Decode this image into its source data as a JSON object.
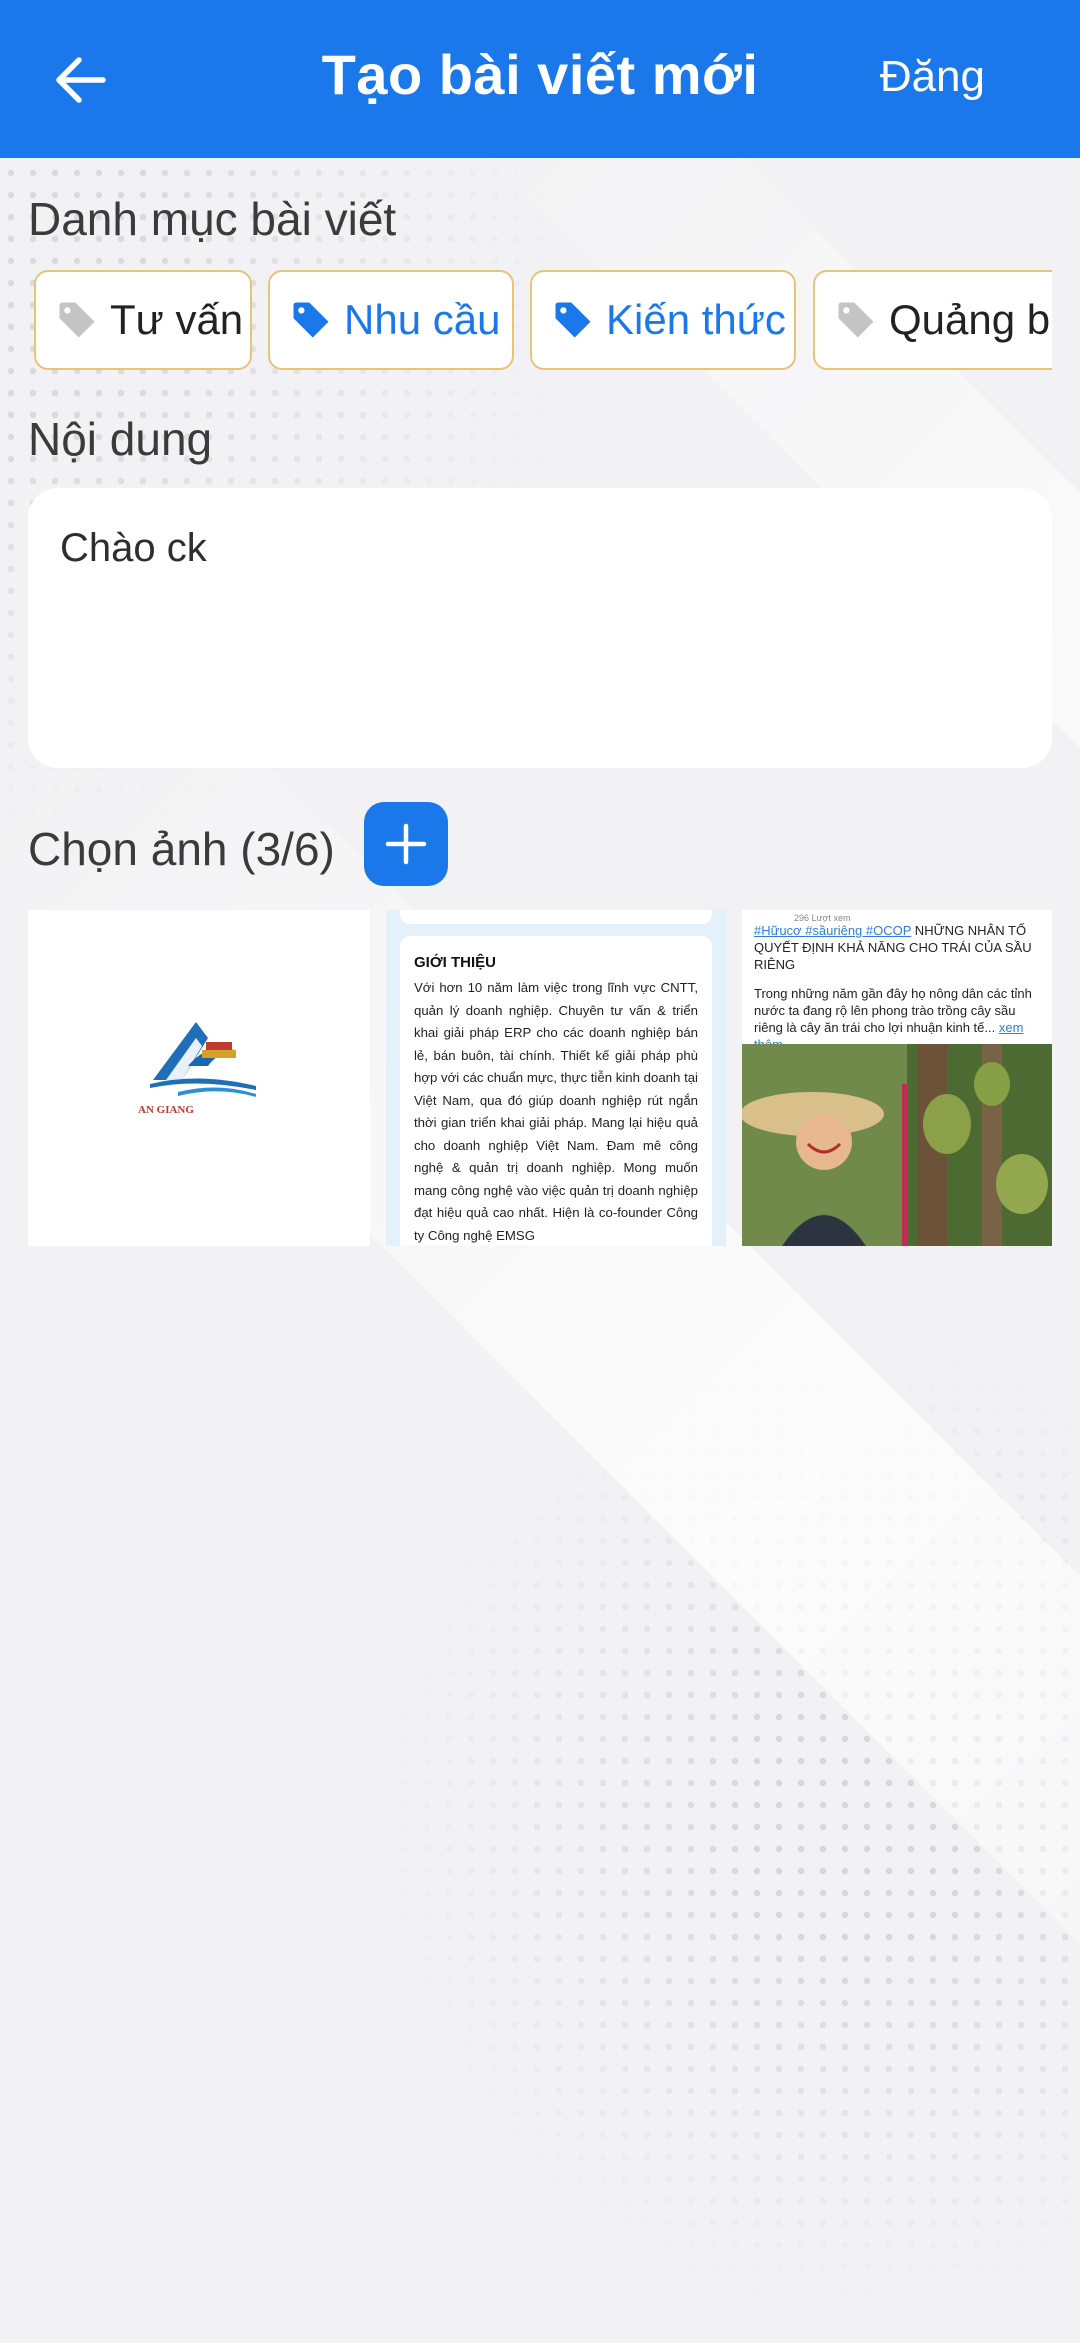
{
  "header": {
    "title": "Tạo bài viết mới",
    "post_label": "Đăng"
  },
  "category": {
    "title": "Danh mục bài viết",
    "chips": [
      {
        "label": "Tư vấn",
        "active": false
      },
      {
        "label": "Nhu cầu",
        "active": true
      },
      {
        "label": "Kiến thức",
        "active": true
      },
      {
        "label": "Quảng bá",
        "active": false
      }
    ]
  },
  "content": {
    "title": "Nội dung",
    "value": "Chào ck"
  },
  "images": {
    "title": "Chọn ảnh (3/6)",
    "thumbs": [
      {
        "logo_text": "AN GIANG"
      },
      {
        "heading": "GIỚI THIỆU",
        "body": "Với hơn 10 năm làm việc trong lĩnh vực CNTT, quản lý doanh nghiệp. Chuyên tư vấn & triển khai giải pháp ERP cho các doanh nghiệp bán lẻ, bán buôn, tài chính. Thiết kế giải pháp phù hợp với các chuẩn mực, thực tiễn kinh doanh tại Việt Nam, qua đó giúp doanh nghiệp rút ngắn thời gian triển khai giải pháp. Mang lại hiệu quả cho doanh nghiệp Việt Nam. Đam mê công nghệ & quản trị doanh nghiệp. Mong muốn mang công nghệ vào việc quản trị doanh nghiệp đạt hiệu quả cao nhất. Hiện là co-founder Công ty Công nghệ EMSG"
      },
      {
        "meta": "296 Lượt xem",
        "tags": "#Hữucơ #sầuriêng #OCOP",
        "headline": " NHỮNG NHÂN TỐ QUYẾT ĐỊNH KHẢ NĂNG CHO TRÁI CỦA SẦU RIÊNG",
        "excerpt": "Trong những năm gần đây họ nông dân các tỉnh nước ta đang rộ lên phong trào trồng cây sầu riêng là cây ăn trái cho lợi nhuận kinh tế... ",
        "more": "xem thêm"
      }
    ]
  },
  "colors": {
    "primary": "#1a78ea",
    "chip_border": "#e8c478",
    "tag_inactive": "#c4c4c4"
  },
  "icons": {
    "back": "arrow-left-icon",
    "tag": "tag-icon",
    "add": "plus-icon"
  }
}
